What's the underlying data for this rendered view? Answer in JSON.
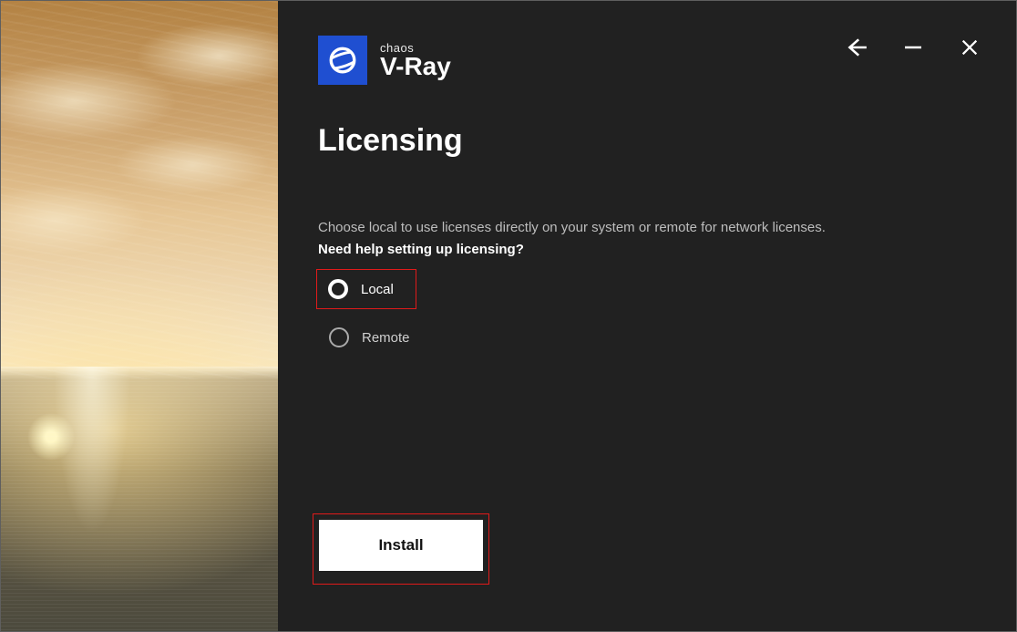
{
  "brand": {
    "small": "chaos",
    "large": "V-Ray"
  },
  "header": {
    "title": "Licensing"
  },
  "body": {
    "subtitle": "Choose local to use licenses directly on your system or remote for network licenses.",
    "help_link": "Need help setting up licensing?"
  },
  "options": {
    "local": {
      "label": "Local",
      "selected": true
    },
    "remote": {
      "label": "Remote",
      "selected": false
    }
  },
  "action": {
    "install_label": "Install"
  },
  "window_controls": {
    "back": "back-arrow",
    "minimize": "minimize",
    "close": "close"
  },
  "highlight_color": "#e01a1a",
  "accent_color": "#1f4fd1"
}
